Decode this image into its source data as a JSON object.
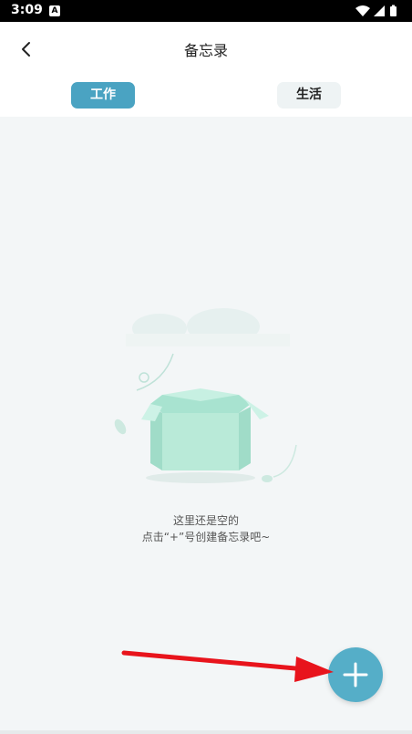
{
  "status_bar": {
    "time": "3:09",
    "notification_icon": "A",
    "icons": [
      "wifi-icon",
      "signal-icon",
      "battery-icon"
    ]
  },
  "header": {
    "title": "备忘录",
    "back_icon": "chevron-left-icon"
  },
  "tabs": [
    {
      "label": "工作",
      "active": true
    },
    {
      "label": "生活",
      "active": false
    }
  ],
  "empty_state": {
    "line1": "这里还是空的",
    "line2": "点击“+”号创建备忘录吧~",
    "illustration_icon": "empty-box-icon"
  },
  "fab": {
    "icon": "plus-icon"
  },
  "colors": {
    "accent": "#4aa3c2",
    "fab": "#55aec8",
    "background": "#f3f6f7",
    "annotation_arrow": "#e8141c"
  }
}
